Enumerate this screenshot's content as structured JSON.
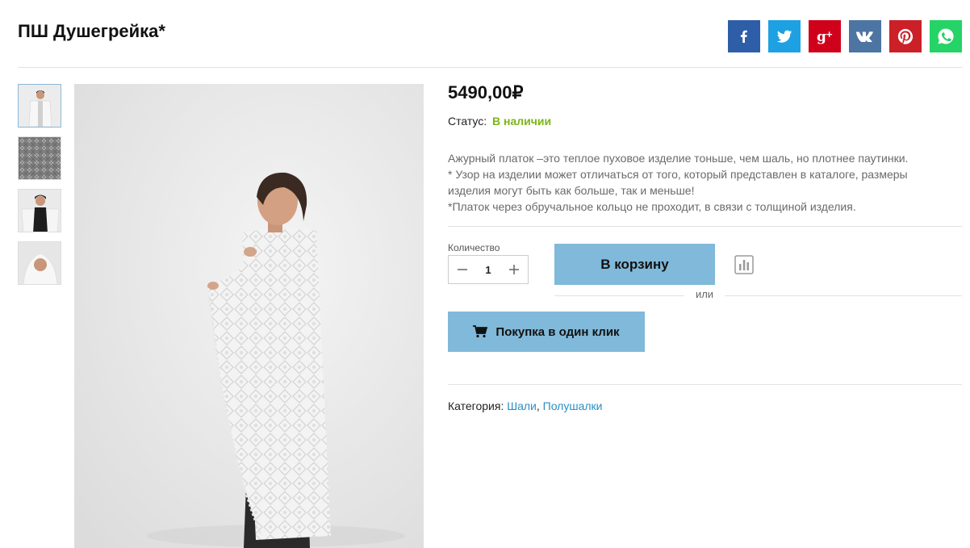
{
  "product": {
    "title": "ПШ Душегрейка*",
    "price": "5490,00₽",
    "status_label": "Статус:",
    "status_value": "В наличии",
    "description": [
      "Ажурный платок –это теплое пуховое изделие тоньше, чем шаль, но плотнее паутинки.",
      "* Узор на изделии может отличаться от того, который представлен в каталоге, размеры изделия могут быть как больше, так и меньше!",
      "*Платок через обручальное кольцо не проходит, в связи с толщиной изделия."
    ]
  },
  "social": [
    {
      "name": "facebook-icon",
      "color": "#2f5ea8"
    },
    {
      "name": "twitter-icon",
      "color": "#1da1e2"
    },
    {
      "name": "google-plus-icon",
      "color": "#d0021b"
    },
    {
      "name": "vk-icon",
      "color": "#4c75a3"
    },
    {
      "name": "pinterest-icon",
      "color": "#cb2027"
    },
    {
      "name": "whatsapp-icon",
      "color": "#25d366"
    }
  ],
  "purchase": {
    "quantity_label": "Количество",
    "quantity_value": "1",
    "cart_label": "В корзину",
    "or_label": "или",
    "oneclick_label": "Покупка в один клик"
  },
  "category": {
    "label": "Категория:",
    "links": [
      "Шали",
      "Полушалки"
    ],
    "separator": ", "
  },
  "colors": {
    "accent": "#80b9d9",
    "in_stock": "#7cb518",
    "link": "#2a8fc5"
  }
}
